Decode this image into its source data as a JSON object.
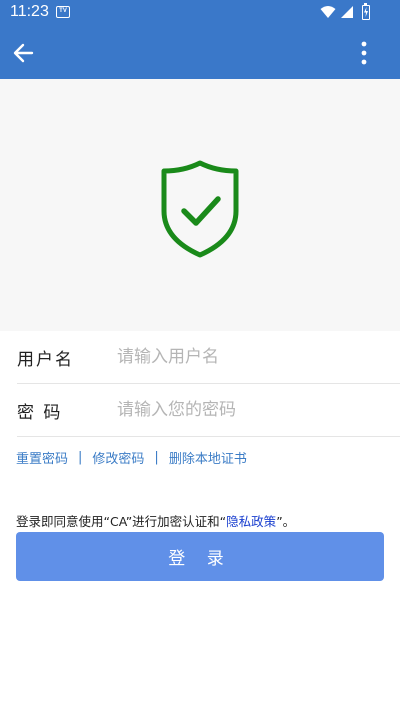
{
  "status_bar": {
    "time": "11:23",
    "badge": "TV"
  },
  "form": {
    "username_label": "用户名",
    "username_placeholder": "请输入用户名",
    "password_label": "密 码",
    "password_placeholder": "请输入您的密码"
  },
  "links": {
    "reset_password": "重置密码",
    "separator": "|",
    "change_password": "修改密码",
    "delete_certificate": "删除本地证书"
  },
  "agreement": {
    "prefix": "登录即同意使用“CA”进行加密认证和“",
    "policy": "隐私政策",
    "suffix": "”。"
  },
  "login_button": "登 录",
  "colors": {
    "primary": "#3a78c9",
    "button": "#6090e8",
    "shield": "#1a8a1a",
    "link": "#3b7cc6"
  }
}
